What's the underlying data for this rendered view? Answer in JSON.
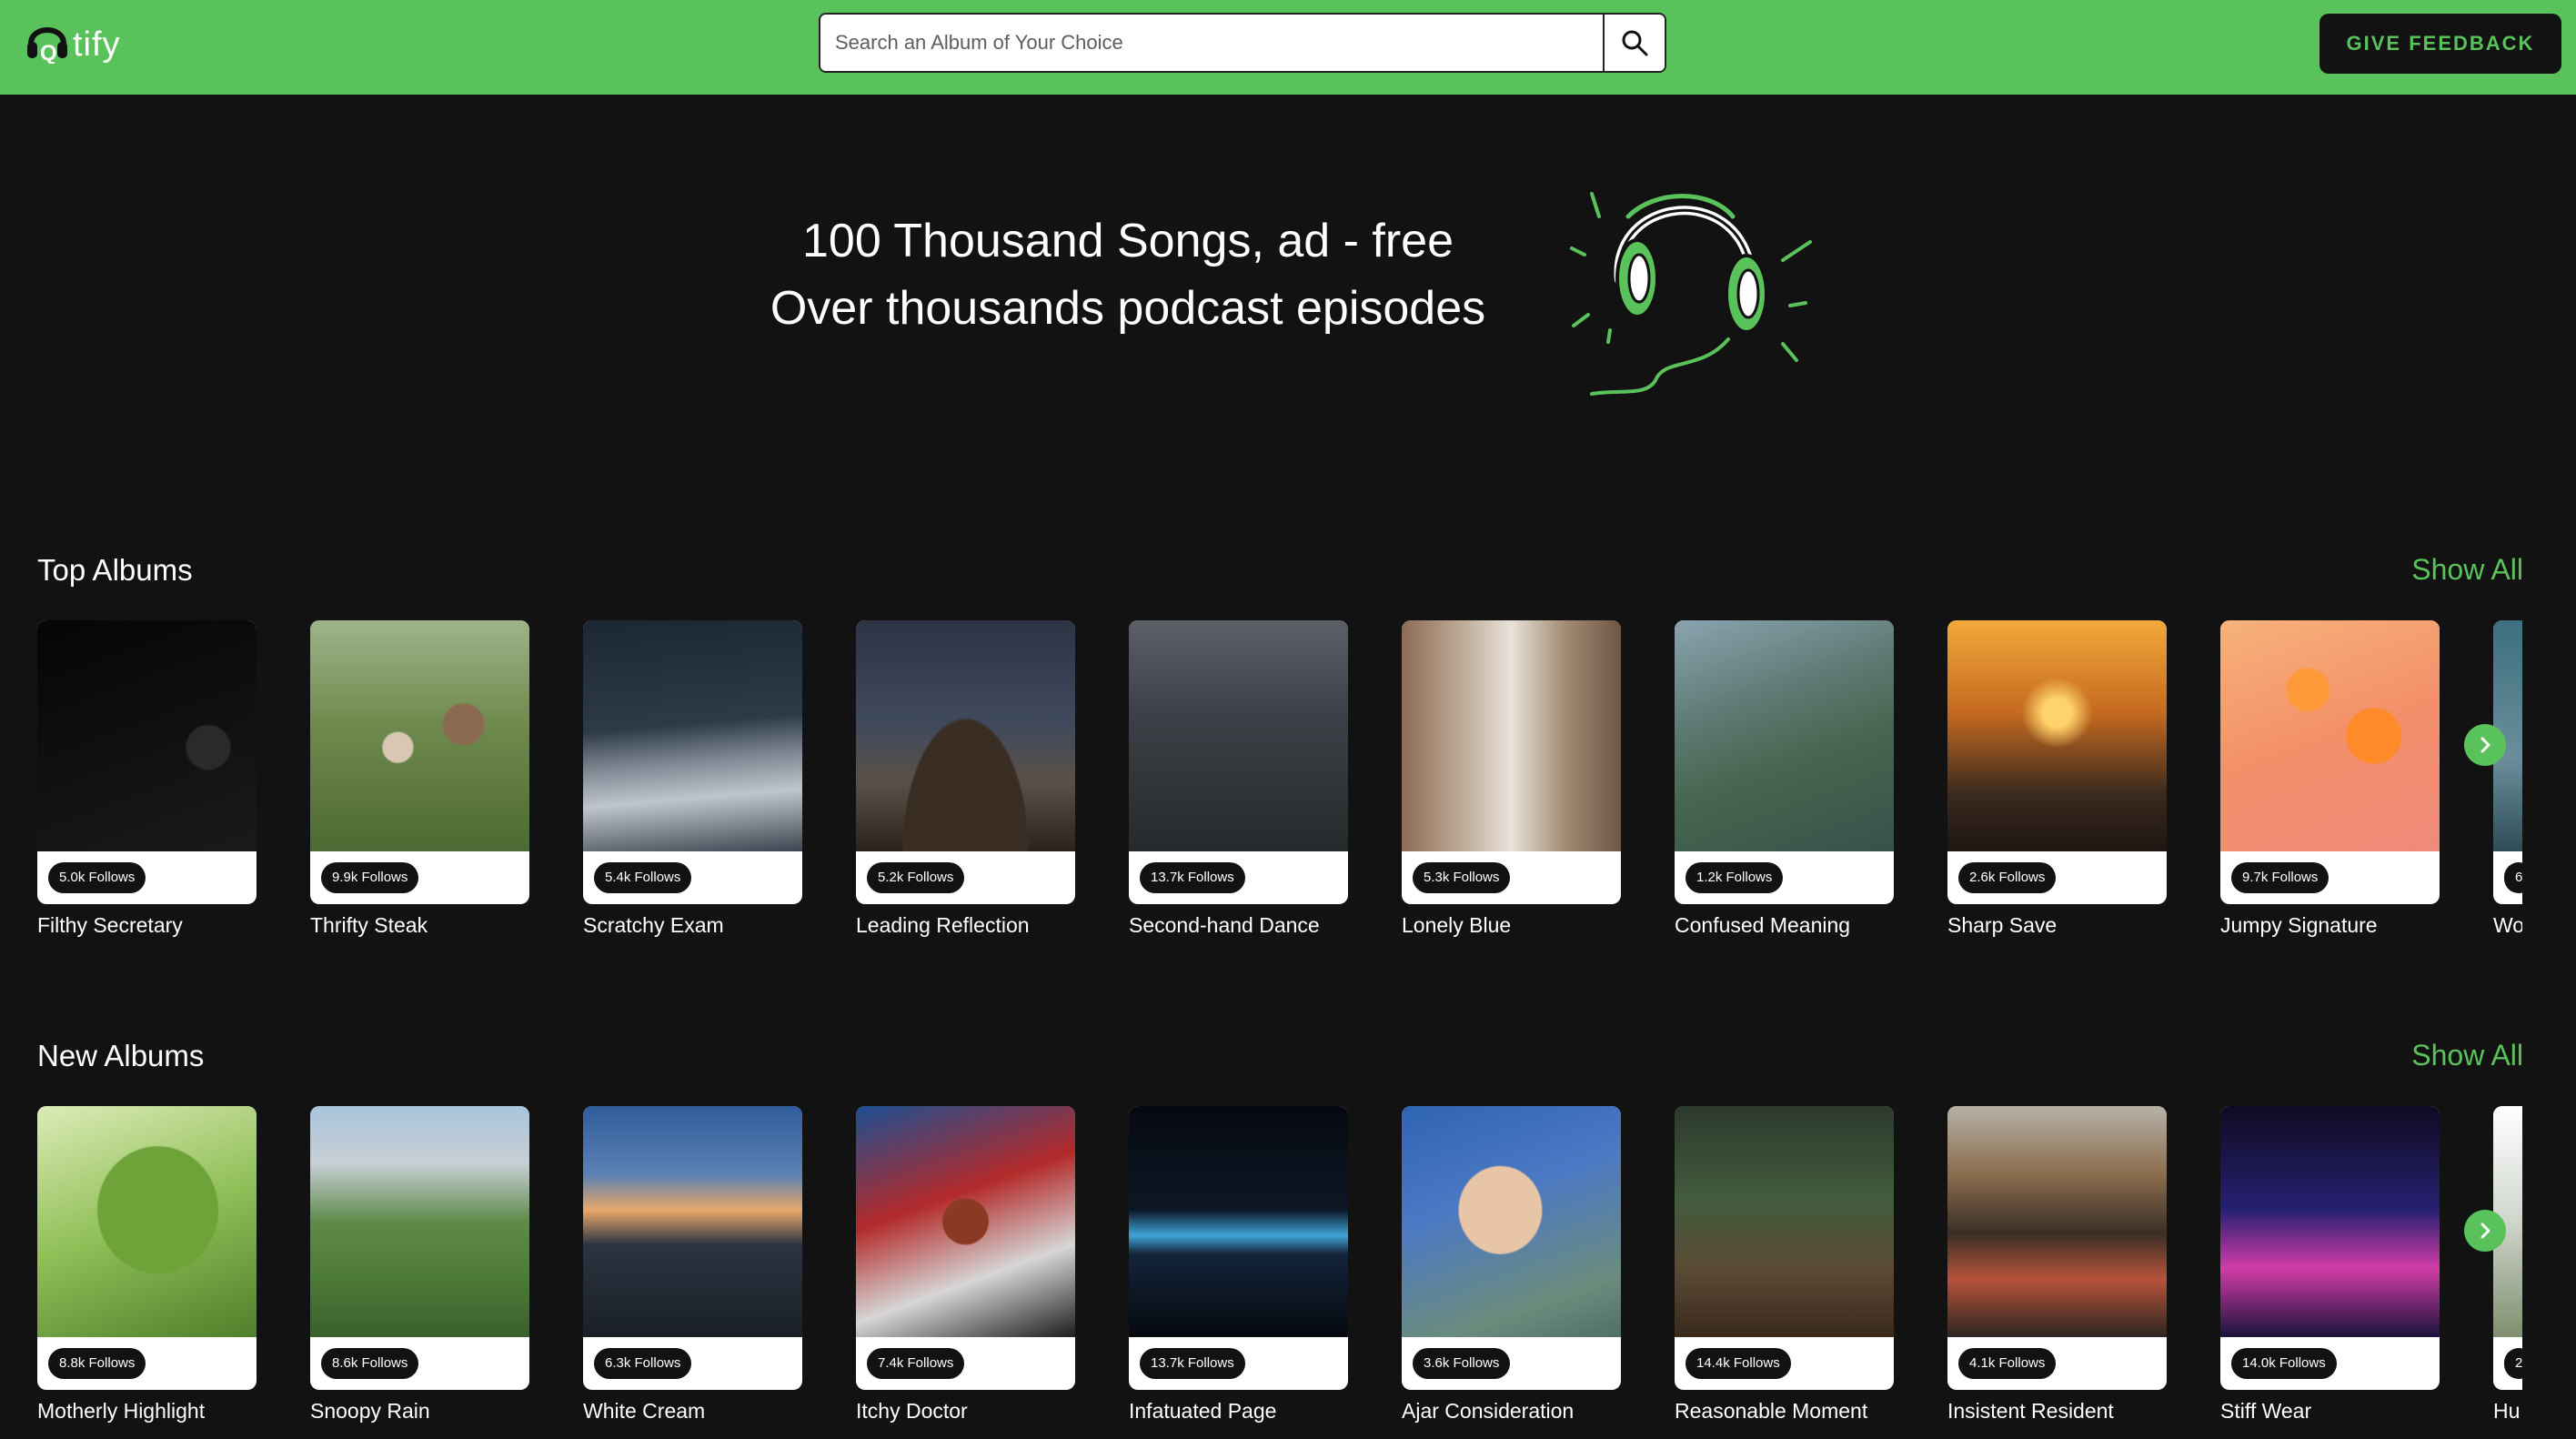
{
  "brand": {
    "logo_text": "tify"
  },
  "search": {
    "placeholder": "Search an Album of Your Choice"
  },
  "header": {
    "feedback_label": "GIVE FEEDBACK"
  },
  "hero": {
    "line1": "100 Thousand Songs, ad - free",
    "line2": "Over thousands podcast episodes"
  },
  "colors": {
    "accent": "#5ac25a",
    "background": "#121212",
    "card_bg": "#ffffff"
  },
  "sections": [
    {
      "title": "Top Albums",
      "show_all": "Show All",
      "albums": [
        {
          "title": "Filthy Secretary",
          "follows": "5.0k Follows"
        },
        {
          "title": "Thrifty Steak",
          "follows": "9.9k Follows"
        },
        {
          "title": "Scratchy Exam",
          "follows": "5.4k Follows"
        },
        {
          "title": "Leading Reflection",
          "follows": "5.2k Follows"
        },
        {
          "title": "Second-hand Dance",
          "follows": "13.7k Follows"
        },
        {
          "title": "Lonely Blue",
          "follows": "5.3k Follows"
        },
        {
          "title": "Confused Meaning",
          "follows": "1.2k Follows"
        },
        {
          "title": "Sharp Save",
          "follows": "2.6k Follows"
        },
        {
          "title": "Jumpy Signature",
          "follows": "9.7k Follows"
        },
        {
          "title": "Wo",
          "follows": "6"
        }
      ]
    },
    {
      "title": "New Albums",
      "show_all": "Show All",
      "albums": [
        {
          "title": "Motherly Highlight",
          "follows": "8.8k Follows"
        },
        {
          "title": "Snoopy Rain",
          "follows": "8.6k Follows"
        },
        {
          "title": "White Cream",
          "follows": "6.3k Follows"
        },
        {
          "title": "Itchy Doctor",
          "follows": "7.4k Follows"
        },
        {
          "title": "Infatuated Page",
          "follows": "13.7k Follows"
        },
        {
          "title": "Ajar Consideration",
          "follows": "3.6k Follows"
        },
        {
          "title": "Reasonable Moment",
          "follows": "14.4k Follows"
        },
        {
          "title": "Insistent Resident",
          "follows": "4.1k Follows"
        },
        {
          "title": "Stiff Wear",
          "follows": "14.0k Follows"
        },
        {
          "title": "Hu",
          "follows": "2"
        }
      ]
    }
  ]
}
